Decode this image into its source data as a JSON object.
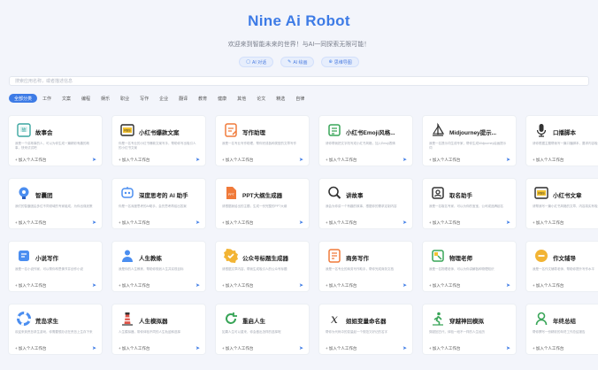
{
  "header": {
    "title": "Nine Ai Robot",
    "subtitle": "欢迎来到智能未来的世界！与AI一同探索无限可能！",
    "buttons": [
      {
        "label": "AI 对话",
        "icon": "chat-icon"
      },
      {
        "label": "AI 绘画",
        "icon": "brush-icon"
      },
      {
        "label": "思维导图",
        "icon": "mindmap-icon"
      }
    ]
  },
  "search": {
    "placeholder": "搜索应用名称，或者描述信息"
  },
  "categories": [
    {
      "label": "全部分类",
      "active": true
    },
    {
      "label": "工作"
    },
    {
      "label": "文案"
    },
    {
      "label": "编程"
    },
    {
      "label": "娱乐"
    },
    {
      "label": "职业"
    },
    {
      "label": "写作"
    },
    {
      "label": "企业"
    },
    {
      "label": "翻译"
    },
    {
      "label": "教育"
    },
    {
      "label": "健康"
    },
    {
      "label": "其他"
    },
    {
      "label": "论文"
    },
    {
      "label": "精选"
    },
    {
      "label": "自律"
    }
  ],
  "card_add_label": "加入个人工作台",
  "cards": [
    {
      "title": "故事会",
      "desc": "我是一个讲故事的人，可以为你生成一篇精彩有趣的故事，快来试试吧",
      "icon": "story-book-icon",
      "color": "#3aa6a0"
    },
    {
      "title": "小红书爆款文案",
      "desc": "你是一名专业的小红书爆款文案写手，帮助你写出吸引人的小红书文案",
      "icon": "xiaohongshu-icon",
      "color": "#2b2b2b"
    },
    {
      "title": "写作助理",
      "desc": "我是一名专业写作助理，帮你完成各种类型的文章写作",
      "icon": "writing-icon",
      "color": "#f07a3a"
    },
    {
      "title": "小红书Emoji风格...",
      "desc": "请你帮我把文字改写成小红书风格，加入Emoji表情",
      "icon": "note-icon",
      "color": "#39a558"
    },
    {
      "title": "Midjourney提示...",
      "desc": "我是一名提示词生成专家，帮你生成Midjourney绘画提示词",
      "icon": "sailboat-icon",
      "color": "#333"
    },
    {
      "title": "口播脚本",
      "desc": "请你根据主题帮我写一篇口播脚本，要求内容吸引人",
      "icon": "microphone-icon",
      "color": "#333"
    },
    {
      "title": "智囊团",
      "desc": "我们的智囊团由多位不同领域的专家组成，为你出谋划策",
      "icon": "lightbulb-icon",
      "color": "#4b8ef0"
    },
    {
      "title": "深度思考的 AI 助手",
      "desc": "你是一名深度思考的AI助手，会先思考再给出答案",
      "icon": "ai-thinking-icon",
      "color": "#4b8ef0"
    },
    {
      "title": "PPT大纲生成器",
      "desc": "请根据我给出的主题，生成一份完整的PPT大纲",
      "icon": "ppt-icon",
      "color": "#f07a3a"
    },
    {
      "title": "讲故事",
      "desc": "我会为你讲一个有趣的故事，根据你的需求定制内容",
      "icon": "magnifier-icon",
      "color": "#333"
    },
    {
      "title": "取名助手",
      "desc": "我是一名取名专家，可以为你的宝宝、公司或品牌起名",
      "icon": "name-card-icon",
      "color": "#333"
    },
    {
      "title": "小红书文章",
      "desc": "请帮我写一篇小红书风格的文章，内容真实有吸引力",
      "icon": "xiaohongshu-article-icon",
      "color": "#2b2b2b"
    },
    {
      "title": "小说写作",
      "desc": "我是一名小说作家，可以帮你构思情节并创作小说",
      "icon": "novel-icon",
      "color": "#4b8ef0"
    },
    {
      "title": "人生教练",
      "desc": "我是你的人生教练，帮助你规划人生并实现目标",
      "icon": "coach-icon",
      "color": "#4b8ef0"
    },
    {
      "title": "公众号标题生成器",
      "desc": "请根据文章内容，帮我生成吸引人的公众号标题",
      "icon": "check-badge-icon",
      "color": "#f2b434"
    },
    {
      "title": "商务写作",
      "desc": "我是一名专业的商务写作助手，帮你完成商务文档",
      "icon": "business-writing-icon",
      "color": "#f07a3a"
    },
    {
      "title": "物理老师",
      "desc": "我是一名物理老师，可以为你讲解各种物理知识",
      "icon": "physics-icon",
      "color": "#39a558"
    },
    {
      "title": "作文辅导",
      "desc": "我是一名作文辅导老师，帮助你提升写作水平",
      "icon": "essay-icon",
      "color": "#f2b434"
    },
    {
      "title": "荒岛求生",
      "desc": "欢迎来到荒岛求生游戏，你需要想办法在荒岛上生存下来",
      "icon": "lifebuoy-icon",
      "color": "#4b8ef0"
    },
    {
      "title": "人生模拟器",
      "desc": "人生模拟器，带你体验不同的人生轨迹和选择",
      "icon": "lighthouse-icon",
      "color": "#e0554a"
    },
    {
      "title": "重启人生",
      "desc": "如果人生可以重来，你会做出怎样的选择呢",
      "icon": "restart-icon",
      "color": "#39a558"
    },
    {
      "title": "姐姐变量命名器",
      "desc": "帮你为代码中的变量起一个规范又好记的名字",
      "icon": "variable-icon",
      "color": "#333"
    },
    {
      "title": "穿越神回模拟",
      "desc": "穿越回古代，体验一段不一样的人生经历",
      "icon": "walker-icon",
      "color": "#39a558"
    },
    {
      "title": "年终总结",
      "desc": "帮你撰写一份精彩的年终工作总结报告",
      "icon": "person-icon",
      "color": "#39a558"
    }
  ]
}
